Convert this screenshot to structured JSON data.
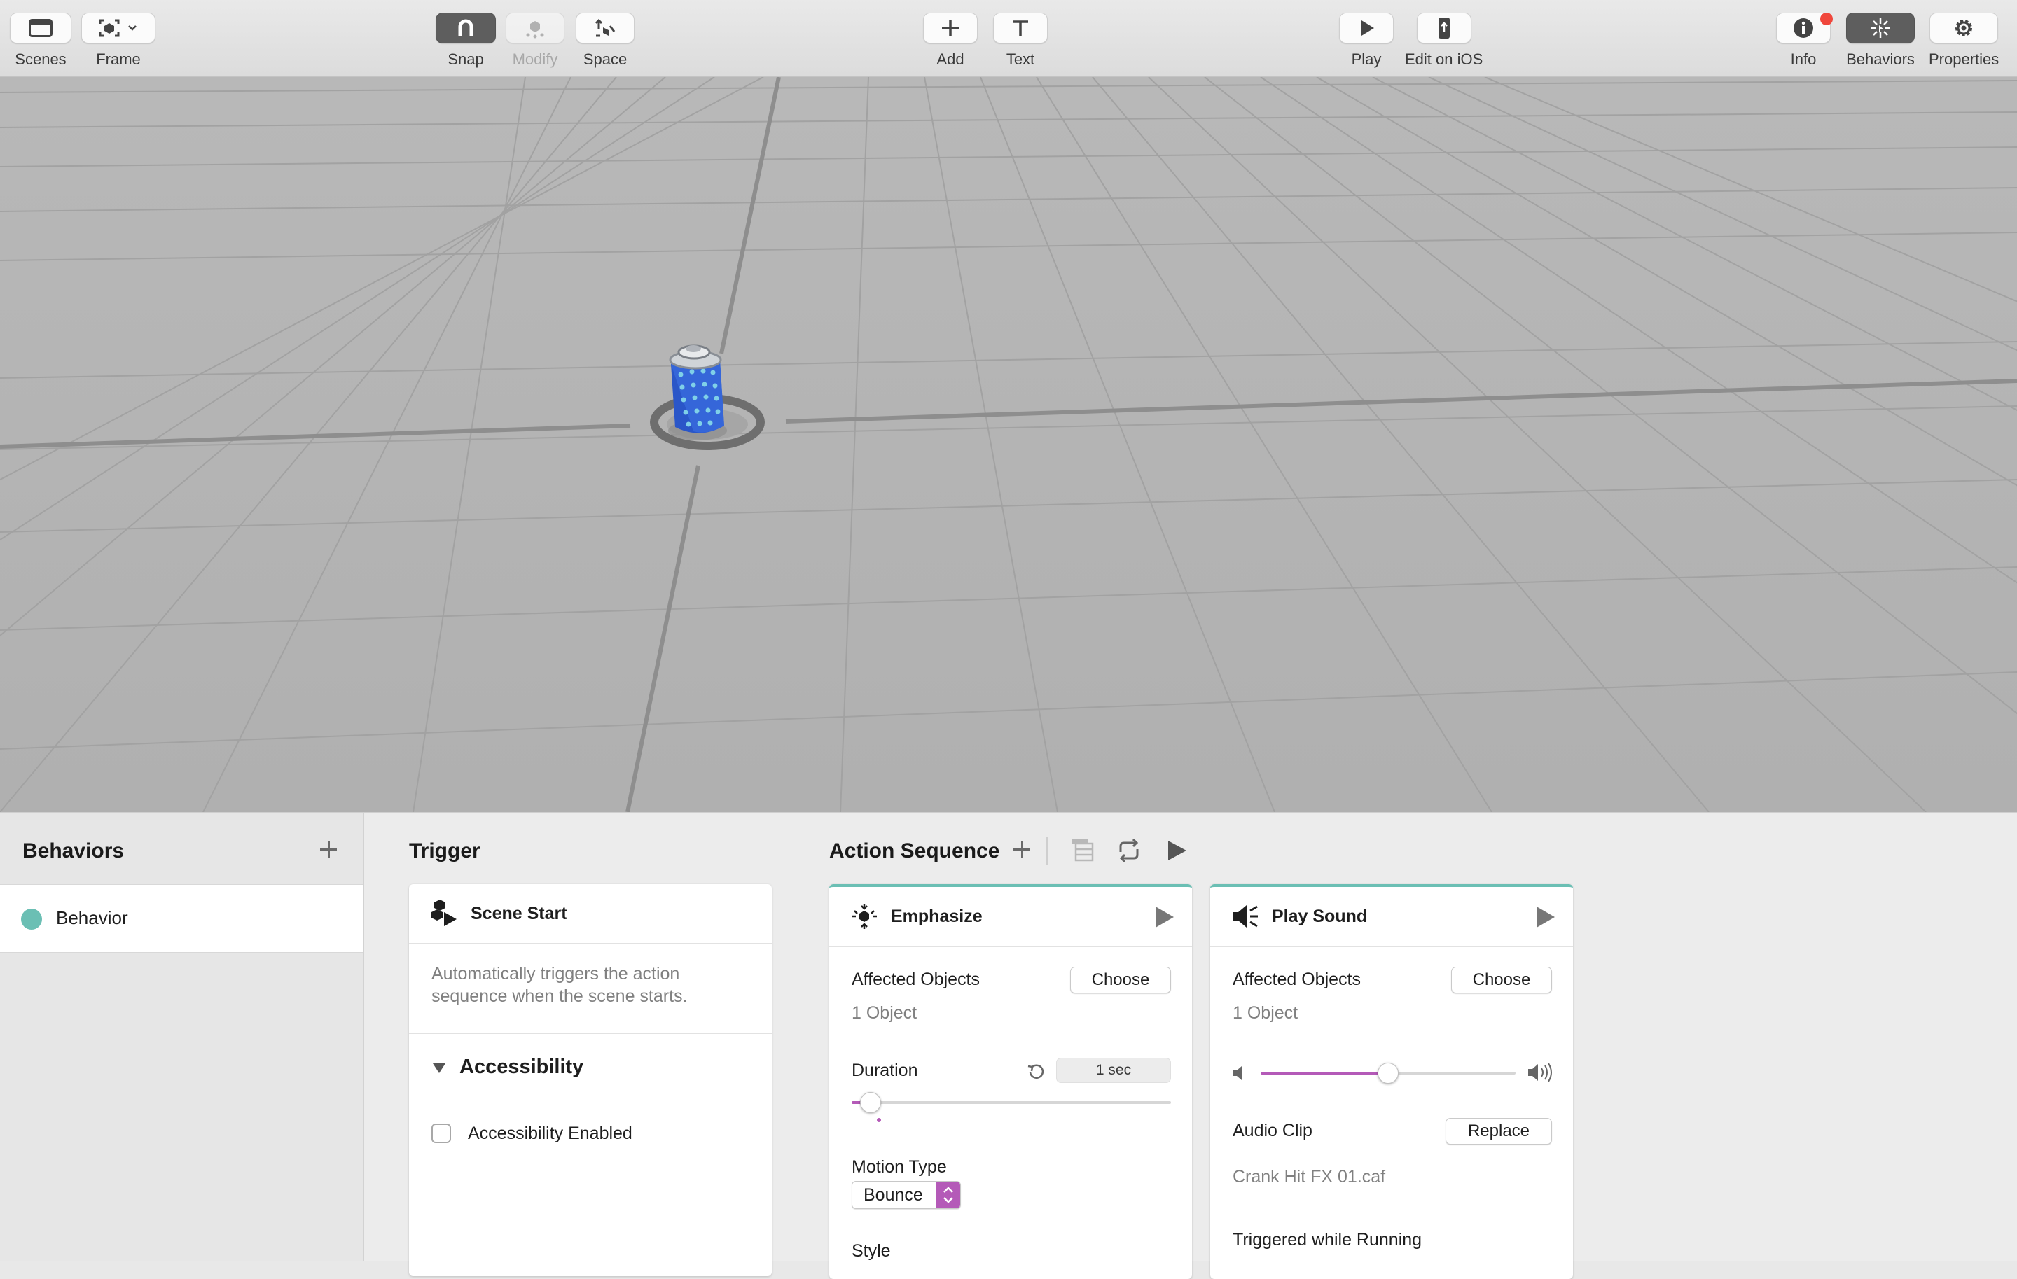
{
  "toolbar": {
    "scenes": "Scenes",
    "frame": "Frame",
    "snap": "Snap",
    "modify": "Modify",
    "space": "Space",
    "add": "Add",
    "text": "Text",
    "play": "Play",
    "edit_on_ios": "Edit on iOS",
    "info": "Info",
    "behaviors": "Behaviors",
    "properties": "Properties"
  },
  "icons": {
    "scenes": "sidebar-icon",
    "frame": "frame-icon",
    "snap": "magnet-icon",
    "modify": "modify-icon",
    "space": "space-icon",
    "add": "plus-icon",
    "text": "text-icon",
    "play": "play-icon",
    "edit_on_ios": "phone-icon",
    "info": "info-icon",
    "behaviors": "behaviors-icon",
    "properties": "gear-icon"
  },
  "colors": {
    "accent_teal": "#6bbfb4",
    "accent_purple": "#b45ab8",
    "notification_red": "#f0473c",
    "active_toolbar": "#5e5e5e"
  },
  "behaviors_pane": {
    "title": "Behaviors",
    "items": [
      {
        "label": "Behavior",
        "color": "#6bbfb4"
      }
    ]
  },
  "trigger": {
    "title": "Trigger",
    "card_title": "Scene Start",
    "description_line1": "Automatically triggers the action",
    "description_line2": "sequence when the scene starts.",
    "section": "Accessibility",
    "checkbox_label": "Accessibility Enabled",
    "checkbox_checked": false
  },
  "action_sequence": {
    "title": "Action Sequence",
    "emphasize": {
      "title": "Emphasize",
      "affected_label": "Affected Objects",
      "choose": "Choose",
      "objects": "1 Object",
      "duration_label": "Duration",
      "duration_value": "1 sec",
      "duration_slider": 0.06,
      "motion_label": "Motion Type",
      "motion_value": "Bounce",
      "style_label": "Style"
    },
    "play_sound": {
      "title": "Play Sound",
      "affected_label": "Affected Objects",
      "choose": "Choose",
      "objects": "1 Object",
      "volume": 0.5,
      "audio_label": "Audio Clip",
      "replace": "Replace",
      "clip_name": "Crank Hit FX 01.caf",
      "triggered_label": "Triggered while Running"
    }
  }
}
